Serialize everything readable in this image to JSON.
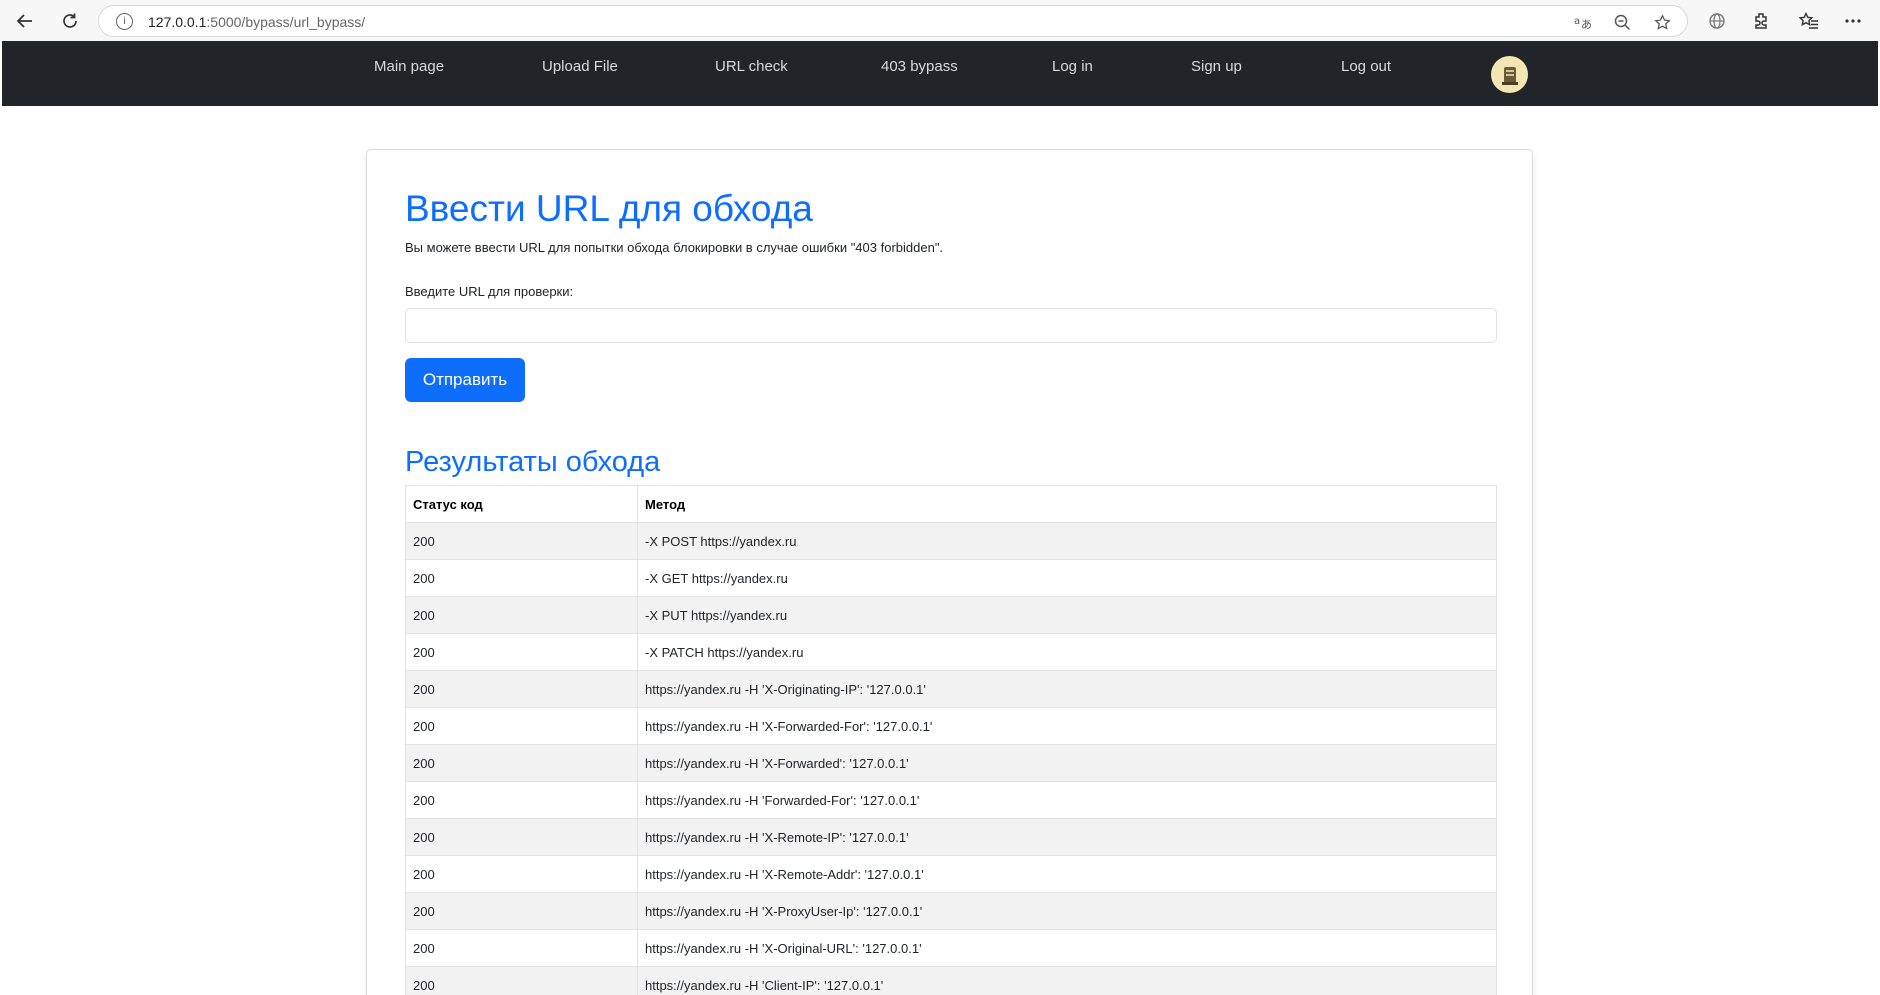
{
  "browser": {
    "url_host": "127.0.0.1",
    "url_rest": ":5000/bypass/url_bypass/"
  },
  "navbar": {
    "links": [
      "Main page",
      "Upload File",
      "URL check",
      "403 bypass",
      "Log in",
      "Sign up",
      "Log out"
    ]
  },
  "page": {
    "title": "Ввести URL для обхода",
    "description": "Вы можете ввести URL для попытки обхода блокировки в случае ошибки \"403 forbidden\".",
    "input_label": "Введите URL для проверки:",
    "input_value": "",
    "submit_label": "Отправить",
    "results_title": "Результаты обхода"
  },
  "results_table": {
    "headers": [
      "Статус код",
      "Метод"
    ],
    "rows": [
      [
        "200",
        "-X POST https://yandex.ru"
      ],
      [
        "200",
        "-X GET https://yandex.ru"
      ],
      [
        "200",
        "-X PUT https://yandex.ru"
      ],
      [
        "200",
        "-X PATCH https://yandex.ru"
      ],
      [
        "200",
        "https://yandex.ru -H 'X-Originating-IP': '127.0.0.1'"
      ],
      [
        "200",
        "https://yandex.ru -H 'X-Forwarded-For': '127.0.0.1'"
      ],
      [
        "200",
        "https://yandex.ru -H 'X-Forwarded': '127.0.0.1'"
      ],
      [
        "200",
        "https://yandex.ru -H 'Forwarded-For': '127.0.0.1'"
      ],
      [
        "200",
        "https://yandex.ru -H 'X-Remote-IP': '127.0.0.1'"
      ],
      [
        "200",
        "https://yandex.ru -H 'X-Remote-Addr': '127.0.0.1'"
      ],
      [
        "200",
        "https://yandex.ru -H 'X-ProxyUser-Ip': '127.0.0.1'"
      ],
      [
        "200",
        "https://yandex.ru -H 'X-Original-URL': '127.0.0.1'"
      ],
      [
        "200",
        "https://yandex.ru -H 'Client-IP': '127.0.0.1'"
      ]
    ]
  },
  "colors": {
    "accent": "#0d6efd",
    "navbar_bg": "#212529",
    "striped_row": "#f2f2f2"
  },
  "icons": [
    "back-arrow-icon",
    "reload-icon",
    "info-icon",
    "translate-icon",
    "zoom-out-icon",
    "star-icon",
    "globe-icon",
    "extensions-icon",
    "favorites-icon",
    "more-icon",
    "user-avatar-icon"
  ]
}
